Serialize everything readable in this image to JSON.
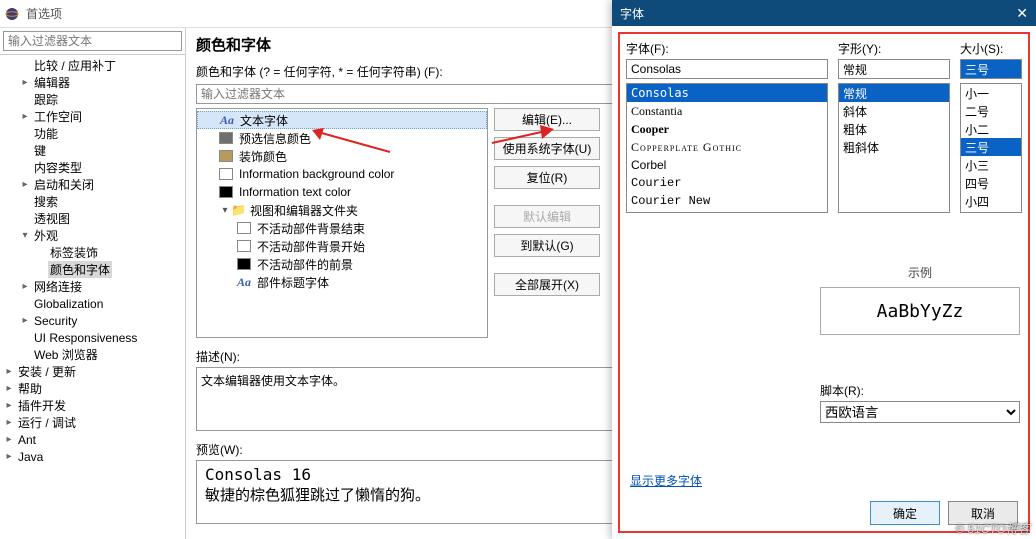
{
  "prefs": {
    "window_title": "首选项",
    "filter_placeholder": "输入过滤器文本",
    "tree": [
      {
        "label": "比较 / 应用补丁",
        "level": 1,
        "exp": ""
      },
      {
        "label": "编辑器",
        "level": 1,
        "exp": ">"
      },
      {
        "label": "跟踪",
        "level": 1,
        "exp": ""
      },
      {
        "label": "工作空间",
        "level": 1,
        "exp": ">"
      },
      {
        "label": "功能",
        "level": 1,
        "exp": ""
      },
      {
        "label": "键",
        "level": 1,
        "exp": ""
      },
      {
        "label": "内容类型",
        "level": 1,
        "exp": ""
      },
      {
        "label": "启动和关闭",
        "level": 1,
        "exp": ">"
      },
      {
        "label": "搜索",
        "level": 1,
        "exp": ""
      },
      {
        "label": "透视图",
        "level": 1,
        "exp": ""
      },
      {
        "label": "外观",
        "level": 1,
        "exp": "v"
      },
      {
        "label": "标签装饰",
        "level": 2,
        "exp": ""
      },
      {
        "label": "颜色和字体",
        "level": 2,
        "exp": "",
        "sel": true
      },
      {
        "label": "网络连接",
        "level": 1,
        "exp": ">"
      },
      {
        "label": "Globalization",
        "level": 1,
        "exp": ""
      },
      {
        "label": "Security",
        "level": 1,
        "exp": ">"
      },
      {
        "label": "UI Responsiveness",
        "level": 1,
        "exp": ""
      },
      {
        "label": "Web 浏览器",
        "level": 1,
        "exp": ""
      },
      {
        "label": "安装 / 更新",
        "level": 0,
        "exp": ">"
      },
      {
        "label": "帮助",
        "level": 0,
        "exp": ">"
      },
      {
        "label": "插件开发",
        "level": 0,
        "exp": ">"
      },
      {
        "label": "运行 / 调试",
        "level": 0,
        "exp": ">"
      },
      {
        "label": "Ant",
        "level": 0,
        "exp": ">"
      },
      {
        "label": "Java",
        "level": 0,
        "exp": ">"
      }
    ]
  },
  "mid": {
    "heading": "颜色和字体",
    "subdesc": "颜色和字体  (? = 任何字符, * = 任何字符串)  (F):",
    "filter_placeholder": "输入过滤器文本",
    "items": [
      {
        "kind": "font",
        "label": "文本字体",
        "sel": true,
        "level": 1
      },
      {
        "kind": "color",
        "color": "#6f6f6f",
        "label": "预选信息颜色",
        "level": 1
      },
      {
        "kind": "color",
        "color": "#b89a5c",
        "label": "装饰颜色",
        "level": 1
      },
      {
        "kind": "color",
        "color": "#ffffff",
        "label": "Information background color",
        "level": 1
      },
      {
        "kind": "color",
        "color": "#000000",
        "label": "Information text color",
        "level": 1
      },
      {
        "kind": "folder",
        "label": "视图和编辑器文件夹",
        "level": 1,
        "exp": "v"
      },
      {
        "kind": "color",
        "color": "#ffffff",
        "label": "不活动部件背景结束",
        "level": 2
      },
      {
        "kind": "color",
        "color": "#ffffff",
        "label": "不活动部件背景开始",
        "level": 2
      },
      {
        "kind": "color",
        "color": "#000000",
        "label": "不活动部件的前景",
        "level": 2
      },
      {
        "kind": "font",
        "label": "部件标题字体",
        "level": 2
      }
    ],
    "buttons": {
      "edit": "编辑(E)...",
      "use_system": "使用系统字体(U)",
      "reset": "复位(R)",
      "default_edit": "默认编辑",
      "to_default": "到默认(G)",
      "expand_all": "全部展开(X)"
    },
    "desc_label": "描述(N):",
    "desc_text": "文本编辑器使用文本字体。",
    "preview_label": "预览(W):",
    "preview_line1": "Consolas 16",
    "preview_line2": "敏捷的棕色狐狸跳过了懒惰的狗。"
  },
  "fontdlg": {
    "title": "字体",
    "labels": {
      "font": "字体(F):",
      "style": "字形(Y):",
      "size": "大小(S):",
      "sample": "示例",
      "script": "脚本(R):",
      "more": "显示更多字体",
      "ok": "确定",
      "cancel": "取消"
    },
    "font_value": "Consolas",
    "fonts": [
      {
        "label": "Consolas",
        "sel": true,
        "style": "font-family:Consolas,monospace"
      },
      {
        "label": "Constantia",
        "style": "font-family:Georgia,serif"
      },
      {
        "label": "Cooper",
        "style": "font-weight:bold;font-family:Georgia,serif"
      },
      {
        "label": "Copperplate Gothic",
        "style": "font-family:'Copperplate',serif;font-variant:small-caps;letter-spacing:1px"
      },
      {
        "label": "Corbel",
        "style": ""
      },
      {
        "label": "Courier",
        "style": "font-family:Courier,monospace"
      },
      {
        "label": "Courier New",
        "style": "font-family:'Courier New',monospace"
      }
    ],
    "style_value": "常规",
    "styles": [
      {
        "label": "常规",
        "sel": true
      },
      {
        "label": "斜体"
      },
      {
        "label": "粗体"
      },
      {
        "label": "粗斜体"
      }
    ],
    "size_value": "三号",
    "sizes": [
      {
        "label": "小一"
      },
      {
        "label": "二号"
      },
      {
        "label": "小二"
      },
      {
        "label": "三号",
        "sel": true
      },
      {
        "label": "小三"
      },
      {
        "label": "四号"
      },
      {
        "label": "小四"
      }
    ],
    "sample": "AaBbYyZz",
    "script": "西欧语言"
  },
  "watermark": "© 51CTO博客"
}
